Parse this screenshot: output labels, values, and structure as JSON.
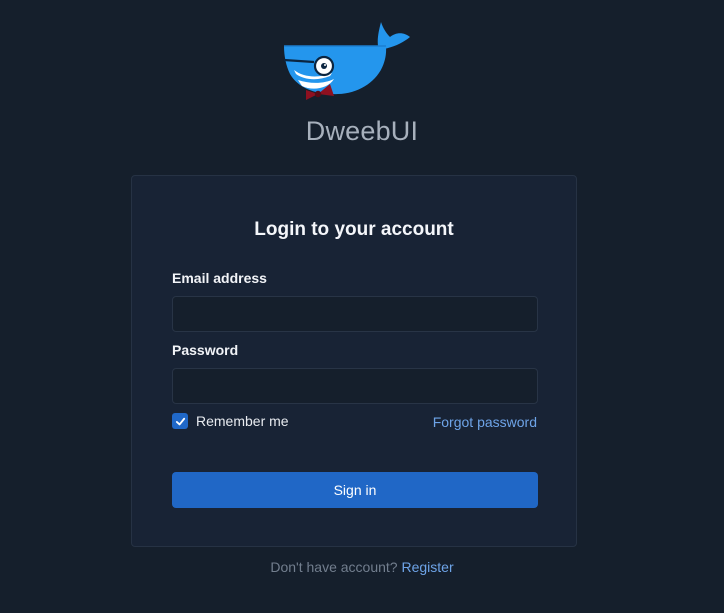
{
  "app": {
    "brand_name": "DweebUI"
  },
  "login": {
    "title": "Login to your account",
    "email_label": "Email address",
    "email_value": "",
    "password_label": "Password",
    "password_value": "",
    "remember_label": "Remember me",
    "remember_checked": true,
    "forgot_label": "Forgot password",
    "signin_label": "Sign in"
  },
  "footer": {
    "prompt": "Don't have account?",
    "register_label": "Register"
  },
  "icons": {
    "logo": "whale-logo-icon",
    "checkbox": "checkmark-icon"
  },
  "colors": {
    "background": "#151f2c",
    "card": "#182335",
    "primary": "#2067c6",
    "link": "#6ea4e8",
    "whale": "#2496ed",
    "bowtie": "#8e1020"
  }
}
